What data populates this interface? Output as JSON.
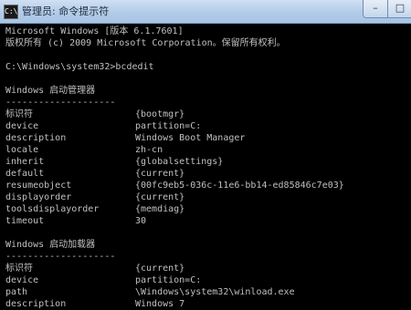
{
  "window": {
    "icon_text": "C:\\",
    "title": "管理员: 命令提示符"
  },
  "console": {
    "lines": [
      "Microsoft Windows [版本 6.1.7601]",
      "版权所有 (c) 2009 Microsoft Corporation。保留所有权利。",
      "",
      "C:\\Windows\\system32>bcdedit",
      "",
      "Windows 启动管理器",
      "--------------------",
      "标识符",
      "device",
      "description",
      "locale",
      "inherit",
      "default",
      "resumeobject",
      "displayorder",
      "toolsdisplayorder",
      "timeout",
      "",
      "Windows 启动加载器",
      "--------------------",
      "标识符",
      "device",
      "path",
      "description"
    ],
    "values": {
      "mgr_id": "{bootmgr}",
      "mgr_device": "partition=C:",
      "mgr_description": "Windows Boot Manager",
      "mgr_locale": "zh-cn",
      "mgr_inherit": "{globalsettings}",
      "mgr_default": "{current}",
      "mgr_resumeobject": "{00fc9eb5-036c-11e6-bb14-ed85846c7e03}",
      "mgr_displayorder": "{current}",
      "mgr_toolsdisplayorder": "{memdiag}",
      "mgr_timeout": "30",
      "ldr_id": "{current}",
      "ldr_device": "partition=C:",
      "ldr_path": "\\Windows\\system32\\winload.exe",
      "ldr_description": "Windows 7"
    }
  }
}
